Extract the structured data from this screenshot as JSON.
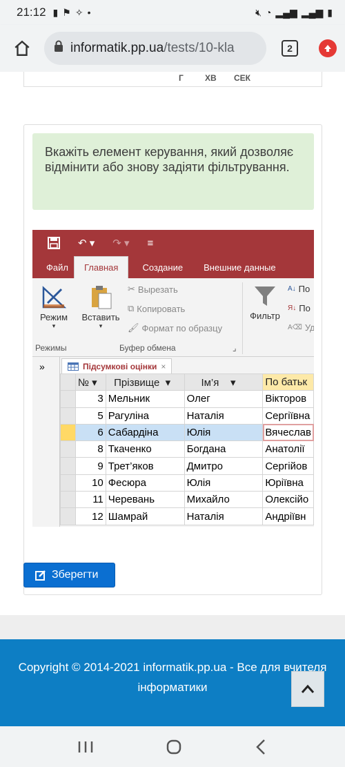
{
  "status": {
    "time": "21:12"
  },
  "browser": {
    "domain": "informatik.pp.ua",
    "path": "/tests/10-kla",
    "tab_count": "2"
  },
  "prev_timer": {
    "h": "Г",
    "m": "ХВ",
    "s": "СЕК"
  },
  "question": {
    "text": "Вкажіть елемент керування, який дозволяє відмінити або знову задіяти фільтрування."
  },
  "access": {
    "tabs": [
      "Файл",
      "Главная",
      "Создание",
      "Внешние данные"
    ],
    "ribbon": {
      "mode": "Режим",
      "paste": "Вставить",
      "cut": "Вырезать",
      "copy": "Копировать",
      "format_painter": "Формат по образцу",
      "filter": "Фильтр",
      "group_modes": "Режимы",
      "group_clipboard": "Буфер обмена",
      "sort_a": "По",
      "sort_b": "По",
      "remove": "Уд"
    },
    "nav_label": "»",
    "doc_tab": "Підсумкові оцінки",
    "columns": [
      "№",
      "Прізвище",
      "Ім’я",
      "По батьк"
    ],
    "rows": [
      [
        "3",
        "Мельник",
        "Олег",
        "Вікторов"
      ],
      [
        "5",
        "Рагуліна",
        "Наталія",
        "Сергіївна"
      ],
      [
        "6",
        "Сабардіна",
        "Юлія",
        "Вячеслав"
      ],
      [
        "8",
        "Ткаченко",
        "Богдана",
        "Анатолії"
      ],
      [
        "9",
        "Трет’яков",
        "Дмитро",
        "Сергійов"
      ],
      [
        "10",
        "Фесюра",
        "Юлія",
        "Юріївна"
      ],
      [
        "11",
        "Черевань",
        "Михайло",
        "Олексійо"
      ],
      [
        "12",
        "Шамрай",
        "Наталія",
        "Андріївн"
      ]
    ],
    "current_row": 2
  },
  "save_label": "Зберегти",
  "footer": {
    "text": "Copyright © 2014-2021 informatik.pp.ua - Все для вчителя інформатики"
  },
  "colors": {
    "accent": "#a4373a",
    "button": "#0b6fd1",
    "footer": "#0d7ec4",
    "question_bg": "#dff0d8"
  }
}
